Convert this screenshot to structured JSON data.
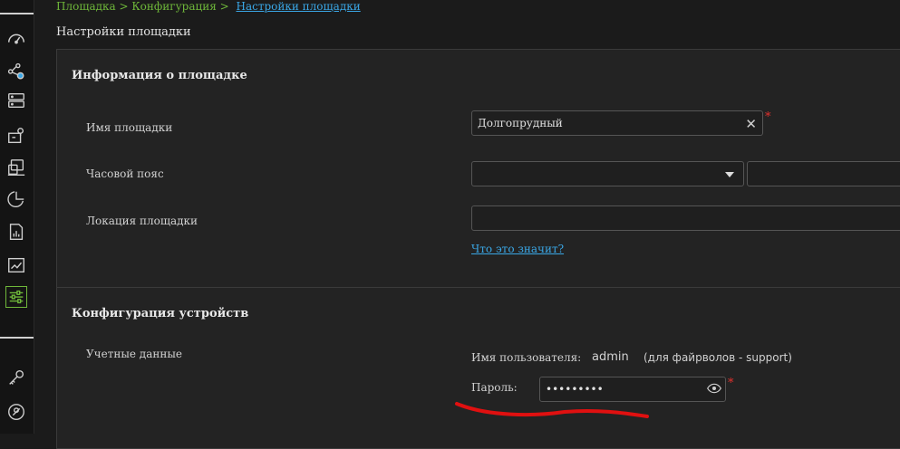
{
  "breadcrumb": {
    "items": [
      "Площадка",
      "Конфигурация"
    ],
    "separator": ">",
    "current": "Настройки площадки"
  },
  "page": {
    "title": "Настройки площадки"
  },
  "site_info": {
    "title": "Информация о площадке",
    "name_label": "Имя площадки",
    "name_value": "Долгопрудный",
    "timezone_label": "Часовой пояс",
    "timezone_value": "",
    "location_label": "Локация площадки",
    "location_value": "",
    "help_link": "Что это значит?",
    "required_mark": "*"
  },
  "device_config": {
    "title": "Конфигурация устройств",
    "credentials_label": "Учетные данные",
    "username_label": "Имя пользователя:",
    "username_value": "admin",
    "username_note": "(для файрволов - support)",
    "password_label": "Пароль:",
    "password_value": "•••••••••",
    "required_mark": "*"
  },
  "colors": {
    "accent_green": "#6fb83a",
    "link_blue": "#3aa7e6",
    "required_red": "#e0302d",
    "annotation_red": "#e01010"
  },
  "sidebar": {
    "icons": [
      "dashboard-icon",
      "topology-icon",
      "server-icon",
      "site-map-icon",
      "devices-icon",
      "pie-chart-icon",
      "report-icon",
      "line-chart-icon",
      "settings-sliders-icon",
      "key-icon",
      "support-icon"
    ]
  }
}
